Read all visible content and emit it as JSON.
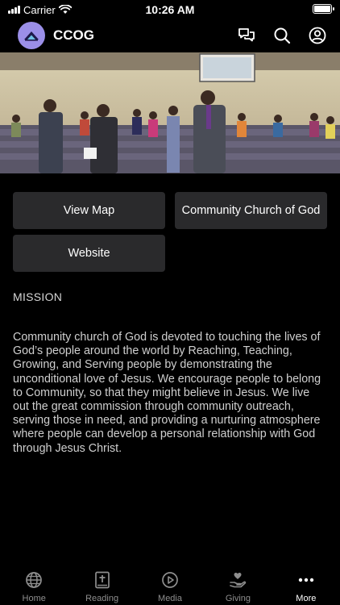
{
  "status": {
    "carrier": "Carrier",
    "time": "10:26 AM",
    "battery_level": 1.0
  },
  "header": {
    "title": "CCOG",
    "icons": [
      "chat-icon",
      "search-icon",
      "account-icon"
    ]
  },
  "hero": {
    "icon": "church-congregation-photo"
  },
  "buttons": {
    "view_map": "View Map",
    "church": "Community Church of God",
    "website": "Website"
  },
  "mission": {
    "label": "MISSION",
    "text": "Community church of God is devoted to touching the lives of God’s people around the world by Reaching, Teaching, Growing, and Serving people by demonstrating the unconditional love of Jesus. We encourage people to belong to Community, so that they might believe in Jesus. We live out the great commission through community outreach, serving those in need, and providing a nurturing atmosphere where people can develop a personal relationship with God through Jesus Christ."
  },
  "tabs": [
    {
      "label": "Home",
      "icon": "globe-icon"
    },
    {
      "label": "Reading",
      "icon": "bible-icon"
    },
    {
      "label": "Media",
      "icon": "play-icon"
    },
    {
      "label": "Giving",
      "icon": "giving-icon"
    },
    {
      "label": "More",
      "icon": "more-icon",
      "active": true
    }
  ],
  "colors": {
    "background": "#000000",
    "button": "#2a2a2c",
    "logo": "#9b8fe8",
    "inactive_tab": "#8e8e8e"
  }
}
